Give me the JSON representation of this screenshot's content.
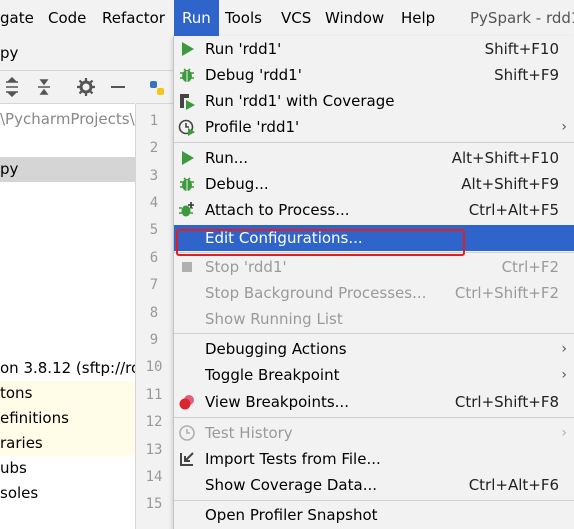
{
  "menubar": {
    "items": [
      "gate",
      "Code",
      "Refactor",
      "Run",
      "Tools",
      "VCS",
      "Window",
      "Help"
    ],
    "title": "PySpark - rdd1"
  },
  "breadcrumb": {
    "text": "py"
  },
  "editor": {
    "tab_label": ""
  },
  "project_panel": {
    "path": "\\PycharmProjects\\",
    "rows": [
      "py",
      "on 3.8.12 (sftp://ro",
      "tons",
      "efinitions",
      "raries",
      "ubs",
      "soles"
    ]
  },
  "gutter": {
    "line_numbers": [
      "1",
      "2",
      "3",
      "4",
      "5",
      "6",
      "7",
      "8",
      "9",
      "10",
      "11",
      "12",
      "13",
      "14",
      "15"
    ]
  },
  "run_menu": {
    "items": [
      {
        "label": "Run 'rdd1'",
        "shortcut": "Shift+F10"
      },
      {
        "label": "Debug 'rdd1'",
        "shortcut": "Shift+F9"
      },
      {
        "label": "Run 'rdd1' with Coverage",
        "shortcut": ""
      },
      {
        "label": "Profile 'rdd1'",
        "shortcut": ""
      },
      {
        "label": "Run...",
        "shortcut": "Alt+Shift+F10"
      },
      {
        "label": "Debug...",
        "shortcut": "Alt+Shift+F9"
      },
      {
        "label": "Attach to Process...",
        "shortcut": "Ctrl+Alt+F5"
      },
      {
        "label": "Edit Configurations...",
        "shortcut": ""
      },
      {
        "label": "Stop 'rdd1'",
        "shortcut": "Ctrl+F2"
      },
      {
        "label": "Stop Background Processes...",
        "shortcut": "Ctrl+Shift+F2"
      },
      {
        "label": "Show Running List",
        "shortcut": ""
      },
      {
        "label": "Debugging Actions",
        "shortcut": ""
      },
      {
        "label": "Toggle Breakpoint",
        "shortcut": ""
      },
      {
        "label": "View Breakpoints...",
        "shortcut": "Ctrl+Shift+F8"
      },
      {
        "label": "Test History",
        "shortcut": ""
      },
      {
        "label": "Import Tests from File...",
        "shortcut": ""
      },
      {
        "label": "Show Coverage Data...",
        "shortcut": "Ctrl+Alt+F6"
      },
      {
        "label": "Open Profiler Snapshot",
        "shortcut": ""
      }
    ]
  },
  "colors": {
    "accent": "#2f65ca",
    "highlight_box": "#e02020",
    "run_green": "#3c9a3c"
  }
}
